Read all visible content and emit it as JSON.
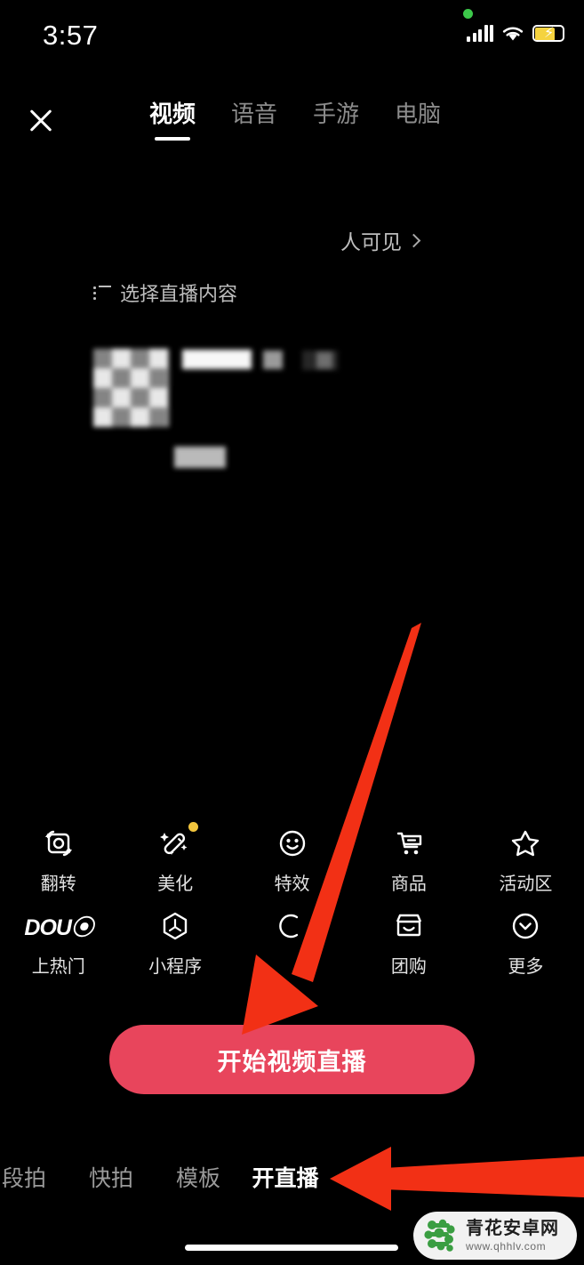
{
  "status_bar": {
    "time": "3:57",
    "icons": [
      "green-recording-dot",
      "signal-bars-icon",
      "wifi-icon",
      "battery-charging-icon"
    ]
  },
  "header": {
    "close_label": "✕",
    "tabs": [
      {
        "label": "视频",
        "active": true
      },
      {
        "label": "语音",
        "active": false
      },
      {
        "label": "手游",
        "active": false
      },
      {
        "label": "电脑",
        "active": false
      }
    ]
  },
  "stream_setup": {
    "visibility_label": "人可见",
    "pick_content_label": "选择直播内容",
    "censored_note": "blurred-title-area"
  },
  "tools": {
    "row1": [
      {
        "label": "翻转",
        "icon": "flip-camera-icon",
        "badge": false
      },
      {
        "label": "美化",
        "icon": "magic-wand-icon",
        "badge": true
      },
      {
        "label": "特效",
        "icon": "smiley-effects-icon",
        "badge": false
      },
      {
        "label": "商品",
        "icon": "shopping-cart-icon",
        "badge": false
      },
      {
        "label": "活动区",
        "icon": "star-icon",
        "badge": false
      }
    ],
    "row2": [
      {
        "label": "上热门",
        "icon": "dou-plus-icon",
        "badge": false
      },
      {
        "label": "小程序",
        "icon": "mini-program-icon",
        "badge": false
      },
      {
        "label": "",
        "icon": "obscured-icon",
        "badge": false
      },
      {
        "label": "团购",
        "icon": "store-icon",
        "badge": false
      },
      {
        "label": "更多",
        "icon": "chevron-down-circle-icon",
        "badge": false
      }
    ]
  },
  "primary_action": {
    "label": "开始视频直播",
    "color": "#E8455C"
  },
  "bottom_nav": {
    "items": [
      {
        "label": "段拍",
        "active": false
      },
      {
        "label": "快拍",
        "active": false
      },
      {
        "label": "模板",
        "active": false
      },
      {
        "label": "开直播",
        "active": true
      }
    ]
  },
  "annotations": {
    "arrow_color": "#F23015",
    "arrows": [
      {
        "name": "arrow-to-start-button",
        "direction": "down-left"
      },
      {
        "name": "arrow-to-live-tab",
        "direction": "left"
      }
    ]
  },
  "watermark": {
    "site_name": "青花安卓网",
    "url": "www.qhhlv.com",
    "logo_color": "#3a9e42"
  }
}
